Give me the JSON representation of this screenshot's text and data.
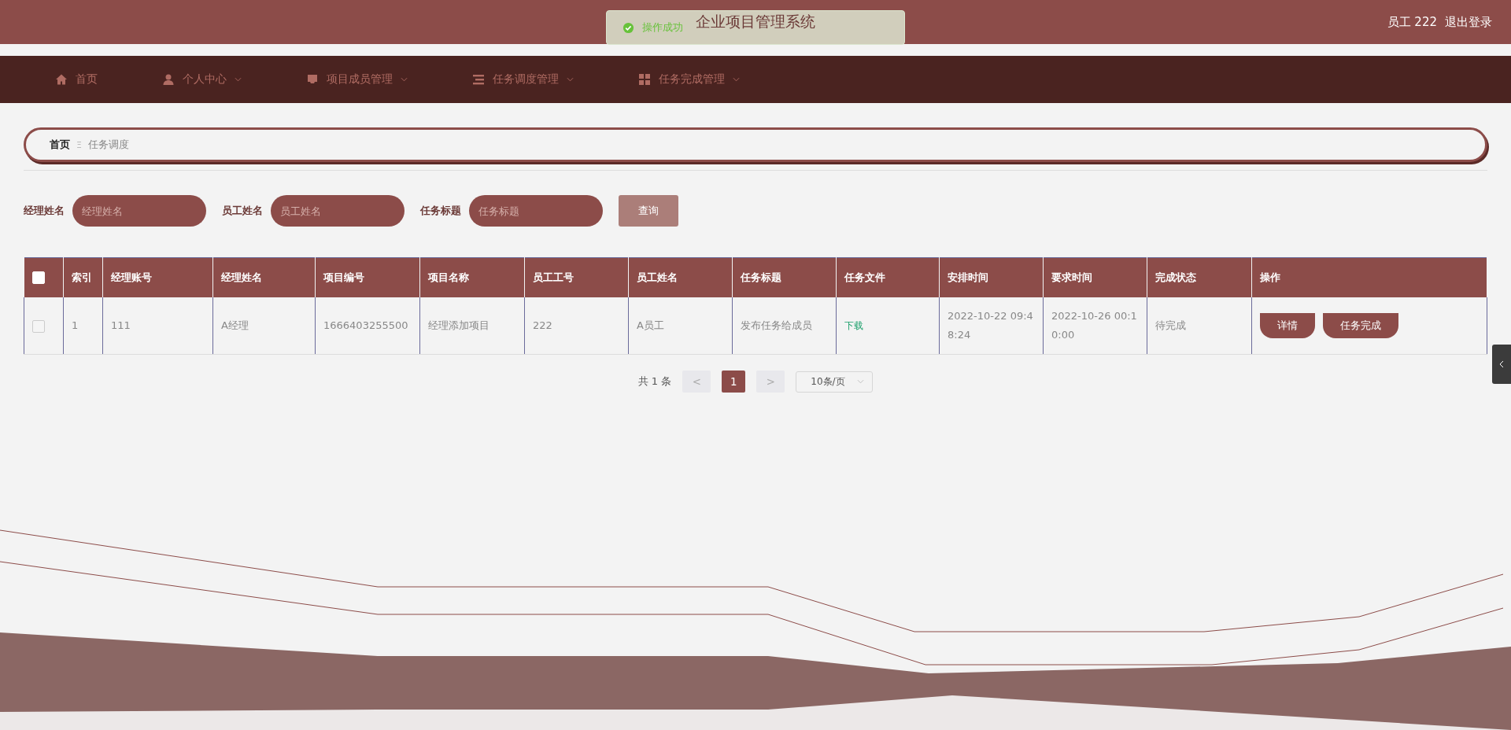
{
  "header": {
    "title": "企业项目管理系统",
    "user": "员工 222",
    "logout": "退出登录"
  },
  "toast": {
    "message": "操作成功"
  },
  "nav": [
    {
      "label": "首页",
      "dropdown": false
    },
    {
      "label": "个人中心",
      "dropdown": true
    },
    {
      "label": "项目成员管理",
      "dropdown": true
    },
    {
      "label": "任务调度管理",
      "dropdown": true
    },
    {
      "label": "任务完成管理",
      "dropdown": true
    }
  ],
  "breadcrumb": {
    "home": "首页",
    "separator": "Ξ",
    "current": "任务调度"
  },
  "search": {
    "fields": [
      {
        "label": "经理姓名",
        "placeholder": "经理姓名"
      },
      {
        "label": "员工姓名",
        "placeholder": "员工姓名"
      },
      {
        "label": "任务标题",
        "placeholder": "任务标题"
      }
    ],
    "button": "查询"
  },
  "table": {
    "columns": [
      "索引",
      "经理账号",
      "经理姓名",
      "项目编号",
      "项目名称",
      "员工工号",
      "员工姓名",
      "任务标题",
      "任务文件",
      "安排时间",
      "要求时间",
      "完成状态",
      "操作"
    ],
    "header_checked": false,
    "rows": [
      {
        "checked": false,
        "cells": [
          "1",
          "111",
          "A经理",
          "1666403255500",
          "经理添加项目",
          "222",
          "A员工",
          "发布任务给成员"
        ],
        "file": "下载",
        "scheduled": "2022-10-22 09:48:24",
        "due": "2022-10-26 00:10:00",
        "status": "待完成",
        "actions": [
          "详情",
          "任务完成"
        ]
      }
    ]
  },
  "pagination": {
    "total": "共 1 条",
    "prev": "<",
    "pages": [
      {
        "label": "1",
        "selected": true
      }
    ],
    "next": ">",
    "page_size": "10条/页"
  }
}
